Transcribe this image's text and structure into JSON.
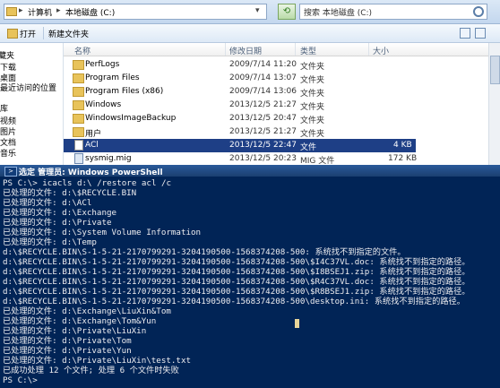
{
  "explorer": {
    "address": {
      "crumbs": [
        "计算机",
        "本地磁盘 (C:)"
      ]
    },
    "search_placeholder": "搜索 本地磁盘 (C:)",
    "toolbar": {
      "open": "打开",
      "new_folder": "新建文件夹"
    },
    "sidebar": [
      {
        "label": "藏夹"
      },
      {
        "label": "下载"
      },
      {
        "label": "桌面"
      },
      {
        "label": "最近访问的位置"
      },
      {
        "label": "库"
      },
      {
        "label": "视频"
      },
      {
        "label": "图片"
      },
      {
        "label": "文档"
      },
      {
        "label": "音乐"
      }
    ],
    "columns": [
      "名称",
      "修改日期",
      "类型",
      "大小"
    ],
    "files": [
      {
        "name": "PerfLogs",
        "date": "2009/7/14 11:20",
        "type": "文件夹",
        "size": "",
        "icon": "folder-icon"
      },
      {
        "name": "Program Files",
        "date": "2009/7/14 13:07",
        "type": "文件夹",
        "size": "",
        "icon": "folder-icon"
      },
      {
        "name": "Program Files (x86)",
        "date": "2009/7/14 13:06",
        "type": "文件夹",
        "size": "",
        "icon": "folder-icon"
      },
      {
        "name": "Windows",
        "date": "2013/12/5 21:27",
        "type": "文件夹",
        "size": "",
        "icon": "folder-icon"
      },
      {
        "name": "WindowsImageBackup",
        "date": "2013/12/5 20:47",
        "type": "文件夹",
        "size": "",
        "icon": "folder-icon"
      },
      {
        "name": "用户",
        "date": "2013/12/5 21:27",
        "type": "文件夹",
        "size": "",
        "icon": "folder-icon"
      },
      {
        "name": "ACl",
        "date": "2013/12/5 22:47",
        "type": "文件",
        "size": "4 KB",
        "icon": "document-icon",
        "selected": true
      },
      {
        "name": "sysmig.mig",
        "date": "2013/12/5 20:23",
        "type": "MIG 文件",
        "size": "172 KB",
        "icon": "mig-file-icon"
      }
    ]
  },
  "powershell": {
    "title_prefix": "选定",
    "title": "管理员: Windows PowerShell",
    "lines": [
      "PS C:\\> icacls d:\\ /restore acl /c",
      "已处理的文件: d:\\$RECYCLE.BIN",
      "已处理的文件: d:\\ACl",
      "已处理的文件: d:\\Exchange",
      "已处理的文件: d:\\Private",
      "已处理的文件: d:\\System Volume Information",
      "已处理的文件: d:\\Temp",
      "d:\\$RECYCLE.BIN\\S-1-5-21-2170799291-3204190500-1568374208-500: 系统找不到指定的文件。",
      "d:\\$RECYCLE.BIN\\S-1-5-21-2170799291-3204190500-1568374208-500\\$I4C37VL.doc: 系统找不到指定的路径。",
      "d:\\$RECYCLE.BIN\\S-1-5-21-2170799291-3204190500-1568374208-500\\$I8BSEJ1.zip: 系统找不到指定的路径。",
      "d:\\$RECYCLE.BIN\\S-1-5-21-2170799291-3204190500-1568374208-500\\$R4C37VL.doc: 系统找不到指定的路径。",
      "d:\\$RECYCLE.BIN\\S-1-5-21-2170799291-3204190500-1568374208-500\\$R8BSEJ1.zip: 系统找不到指定的路径。",
      "d:\\$RECYCLE.BIN\\S-1-5-21-2170799291-3204190500-1568374208-500\\desktop.ini: 系统找不到指定的路径。",
      "已处理的文件: d:\\Exchange\\LiuXin&Tom",
      "已处理的文件: d:\\Exchange\\Tom&Yun",
      "已处理的文件: d:\\Private\\LiuXin",
      "已处理的文件: d:\\Private\\Tom",
      "已处理的文件: d:\\Private\\Yun",
      "已处理的文件: d:\\Private\\LiuXin\\test.txt",
      "已成功处理 12 个文件; 处理 6 个文件时失败",
      "PS C:\\>"
    ]
  },
  "colors": {
    "ps_background": "#012456",
    "ps_text": "#eeedf0",
    "selection": "#1e3f86"
  }
}
